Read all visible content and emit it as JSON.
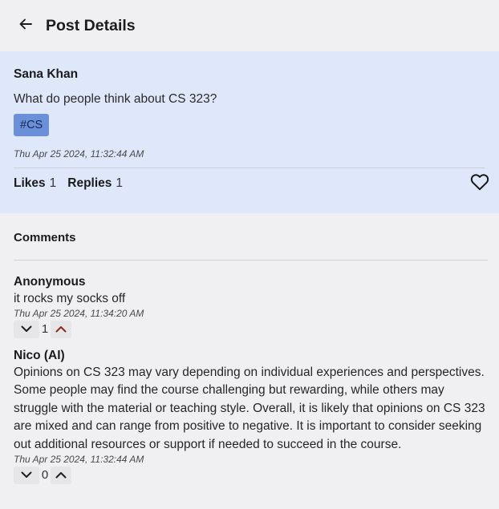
{
  "header": {
    "title": "Post Details",
    "back_icon": "arrow-left-icon"
  },
  "post": {
    "author": "Sana Khan",
    "text": "What do people think about CS 323?",
    "tag": "#CS",
    "timestamp": "Thu Apr 25 2024, 11:32:44 AM",
    "likes_label": "Likes",
    "likes_count": "1",
    "replies_label": "Replies",
    "replies_count": "1",
    "like_icon": "heart-outline-icon"
  },
  "comments": {
    "heading": "Comments",
    "items": [
      {
        "author": "Anonymous",
        "text": "it rocks my socks off",
        "timestamp": "Thu Apr 25 2024, 11:34:20 AM",
        "votes": "1",
        "upvoted": true
      },
      {
        "author": "Nico (AI)",
        "text": "Opinions on CS 323 may vary depending on individual experiences and perspectives. Some people may find the course challenging but rewarding, while others may struggle with the material or teaching style. Overall, it is likely that opinions on CS 323 are mixed and can range from positive to negative. It is important to consider seeking out additional resources or support if needed to succeed in the course.",
        "timestamp": "Thu Apr 25 2024, 11:32:44 AM",
        "votes": "0",
        "upvoted": false
      }
    ]
  },
  "colors": {
    "page_background": "#f0f0f2",
    "post_background": "#dfe8fb",
    "tag_background": "#6b8fd8",
    "upvote_active": "#8b2a1f"
  }
}
